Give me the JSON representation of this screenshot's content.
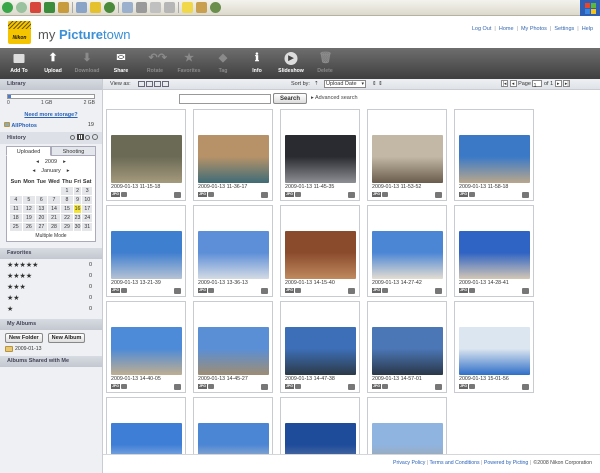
{
  "header": {
    "brand_my": "my",
    "brand_picture": "Picture",
    "brand_town": "town",
    "logo_text": "Nikon",
    "links": [
      "Log Out",
      "Home",
      "My Photos",
      "Settings",
      "Help"
    ]
  },
  "toolbar": {
    "add_to": "Add To",
    "upload": "Upload",
    "download": "Download",
    "share": "Share",
    "rotate": "Rotate",
    "favorites": "Favorites",
    "tag": "Tag",
    "info": "Info",
    "slideshow": "Slideshow",
    "delete": "Delete"
  },
  "library": {
    "title": "Library",
    "tick_0": "0",
    "tick_1": "1 GB",
    "tick_2": "2 GB",
    "used_fraction": 0.04,
    "more_storage": "Need more storage?",
    "all_photos": "AllPhotos",
    "all_photos_count": "19"
  },
  "history": {
    "title": "History",
    "tab_uploaded": "Uploaded",
    "tab_shooting": "Shooting",
    "year": "2009",
    "month": "January",
    "weekdays": [
      "Sun",
      "Mon",
      "Tue",
      "Wed",
      "Thu",
      "Fri",
      "Sat"
    ],
    "days": [
      "",
      "",
      "",
      "",
      "1",
      "2",
      "3",
      "4",
      "5",
      "6",
      "7",
      "8",
      "9",
      "10",
      "11",
      "12",
      "13",
      "14",
      "15",
      "16",
      "17",
      "18",
      "19",
      "20",
      "21",
      "22",
      "23",
      "24",
      "25",
      "26",
      "27",
      "28",
      "29",
      "30",
      "31"
    ],
    "selected_day": "16",
    "multiple_mode": "Multiple Mode"
  },
  "favorites": {
    "title": "Favorites",
    "rows": [
      {
        "stars": "★★★★★",
        "count": "0"
      },
      {
        "stars": "★★★★",
        "count": "0"
      },
      {
        "stars": "★★★",
        "count": "0"
      },
      {
        "stars": "★★",
        "count": "0"
      },
      {
        "stars": "★",
        "count": "0"
      }
    ]
  },
  "albums": {
    "title": "My Albums",
    "new_folder": "New Folder",
    "new_album": "New Album",
    "folder_name": "2009-01-13",
    "shared_title": "Albums Shared with Me"
  },
  "viewbar": {
    "view_as": "View as:",
    "sort_by": "Sort by:",
    "sort_value": "Upload Date",
    "page_label": "Page",
    "page_of": "of 1",
    "page_value": "1"
  },
  "search": {
    "button": "Search",
    "advanced": "Advanced search",
    "query": ""
  },
  "photos": [
    {
      "caption": "2009-01-13 11-15-18",
      "c1": "#6b6a55",
      "c2": "#a59a7d"
    },
    {
      "caption": "2009-01-13 11-36-17",
      "c1": "#b79268",
      "c2": "#3f6c77"
    },
    {
      "caption": "2009-01-13 11-45-35",
      "c1": "#2a2b30",
      "c2": "#8d8f95"
    },
    {
      "caption": "2009-01-13 11-53-52",
      "c1": "#c3b8a6",
      "c2": "#6a5c4c"
    },
    {
      "caption": "2009-01-13 11-58-18",
      "c1": "#3b79c7",
      "c2": "#b9a78c"
    },
    {
      "caption": "2009-01-13 13-21-39",
      "c1": "#3f7fd0",
      "c2": "#b6c3d4"
    },
    {
      "caption": "2009-01-13 13-36-13",
      "c1": "#5c8fd8",
      "c2": "#d4dbe4"
    },
    {
      "caption": "2009-01-13 14-15-40",
      "c1": "#8a4b2d",
      "c2": "#c08a5e"
    },
    {
      "caption": "2009-01-13 14-27-42",
      "c1": "#4b86d5",
      "c2": "#e4ddd2"
    },
    {
      "caption": "2009-01-13 14-28-41",
      "c1": "#2f63c4",
      "c2": "#d4c7b6"
    },
    {
      "caption": "2009-01-13 14-40-05",
      "c1": "#4d8ad8",
      "c2": "#bfae91"
    },
    {
      "caption": "2009-01-13 14-45-27",
      "c1": "#5a8fd6",
      "c2": "#9e8d74"
    },
    {
      "caption": "2009-01-13 14-47-38",
      "c1": "#3d6fb8",
      "c2": "#2c3a48"
    },
    {
      "caption": "2009-01-13 14-57-01",
      "c1": "#4b77b6",
      "c2": "#2a3748"
    },
    {
      "caption": "2009-01-13 15-01-56",
      "c1": "#dce6f0",
      "c2": "#2f6fc8"
    },
    {
      "caption": "",
      "c1": "#3e7ed6",
      "c2": "#c8d8e8"
    },
    {
      "caption": "",
      "c1": "#4b86d5",
      "c2": "#d8d0c4"
    },
    {
      "caption": "",
      "c1": "#1e4b9a",
      "c2": "#7a8ea8"
    },
    {
      "caption": "",
      "c1": "#8fb4e0",
      "c2": "#a8a08e"
    }
  ],
  "footer": {
    "privacy": "Privacy Policy",
    "terms": "Terms and Conditions",
    "powered": "Powered by Picting",
    "copyright": "©2008 Nikon Corporation"
  }
}
